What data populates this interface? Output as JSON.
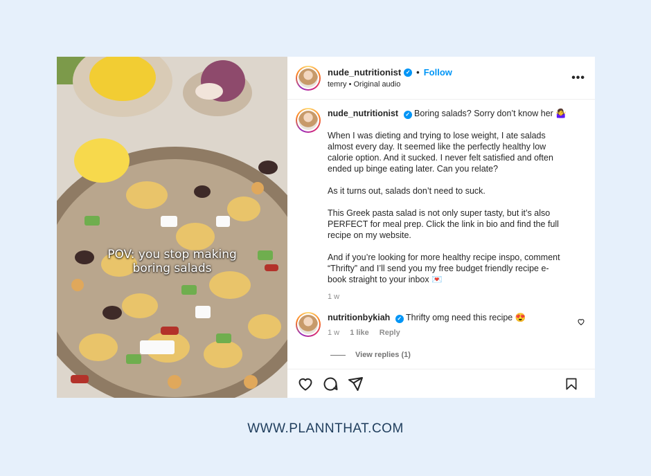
{
  "post": {
    "overlay_line1": "POV: you stop making",
    "overlay_line2": "boring salads"
  },
  "header": {
    "username": "nude_nutritionist",
    "separator": "•",
    "follow_label": "Follow",
    "audio_author": "temry",
    "audio_sep": "•",
    "audio_label": "Original audio",
    "more_label": "•••"
  },
  "caption": {
    "username": "nude_nutritionist",
    "title": "Boring salads? Sorry don’t know her 🤷‍♀️",
    "para1": "When I was dieting and trying to lose weight, I ate salads\nalmost every day. It seemed like the perfectly healthy low\ncalorie option. And it sucked. I never felt satisfied and often\nended up binge eating later. Can you relate?",
    "para2": "As it turns out, salads don’t need to suck.",
    "para3": "This Greek pasta salad is not only super tasty, but it’s also\nPERFECT for meal prep. Click the link in bio and find the full\nrecipe on my website.",
    "para4": "And if you’re looking for more healthy recipe inspo, comment\n“Thrifty” and I’ll send you my free budget friendly recipe e-\nbook straight to your inbox 💌",
    "time": "1 w"
  },
  "comment": {
    "username": "nutritionbykiah",
    "text": "Thrifty omg need this recipe 😍",
    "time": "1 w",
    "likes": "1 like",
    "reply_label": "Reply",
    "view_replies": "View replies (1)"
  },
  "footer": {
    "url": "WWW.PLANNTHAT.COM"
  },
  "colors": {
    "background": "#e6f0fb",
    "link": "#0095f6",
    "footer_text": "#1f3d5c"
  }
}
